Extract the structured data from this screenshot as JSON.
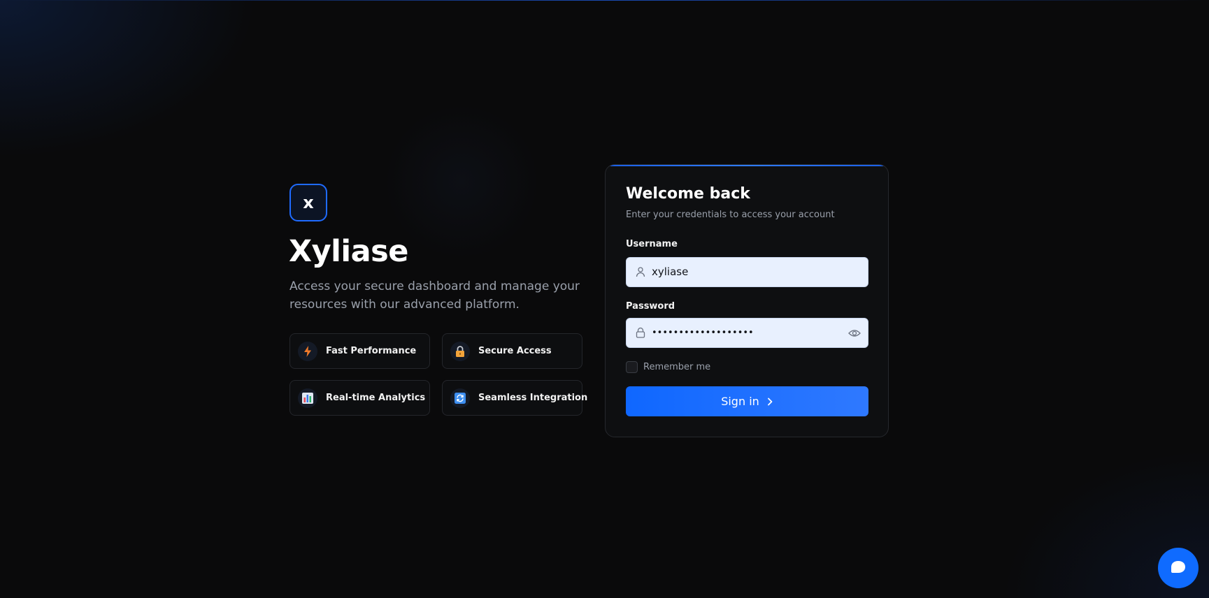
{
  "brand": {
    "logo_letter": "x",
    "name": "Xyliase",
    "tagline": "Access your secure dashboard and manage your resources with our advanced platform."
  },
  "features": [
    {
      "label": "Fast Performance",
      "icon": "lightning-icon"
    },
    {
      "label": "Secure Access",
      "icon": "lock-icon"
    },
    {
      "label": "Real-time Analytics",
      "icon": "bar-chart-icon"
    },
    {
      "label": "Seamless Integration",
      "icon": "sync-icon"
    }
  ],
  "login": {
    "title": "Welcome back",
    "subtitle": "Enter your credentials to access your account",
    "username_label": "Username",
    "username_value": "xyliase",
    "password_label": "Password",
    "password_value": "•••••••••••••••••••",
    "remember_label": "Remember me",
    "remember_checked": false,
    "signin_label": "Sign in"
  },
  "colors": {
    "accent": "#0f67ff",
    "background": "#0a0a0b",
    "input_bg": "#e8f0fe"
  }
}
